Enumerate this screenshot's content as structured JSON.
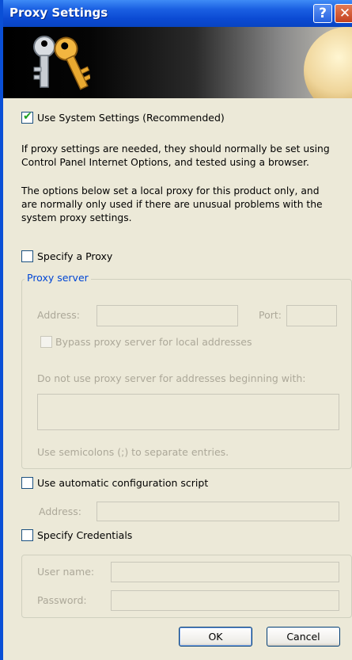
{
  "window": {
    "title": "Proxy Settings",
    "help_glyph": "?",
    "close_glyph": "✕"
  },
  "banner": {
    "icon": "keys-icon"
  },
  "use_system": {
    "label": "Use System Settings (Recommended)",
    "checked": true
  },
  "info": {
    "line1": "If proxy settings are needed, they should normally be set using",
    "line2": "Control Panel Internet Options, and tested using a browser.",
    "line3": "The options below set a local proxy for this product only, and",
    "line4": "are normally only used  if there are unusual problems with the",
    "line5": "system proxy settings."
  },
  "specify_proxy": {
    "label": "Specify a Proxy",
    "checked": false
  },
  "proxy_server": {
    "legend": "Proxy server",
    "address_label": "Address:",
    "address_value": "",
    "port_label": "Port:",
    "port_value": "",
    "bypass_label": "Bypass proxy server for local addresses",
    "exceptions_label": "Do not use proxy server for addresses beginning with:",
    "exceptions_value": "",
    "semicolons_hint": "Use semicolons (;) to separate entries."
  },
  "auto_config": {
    "label": "Use automatic configuration script",
    "checked": false,
    "address_label": "Address:",
    "address_value": ""
  },
  "credentials": {
    "label": "Specify Credentials",
    "checked": false,
    "username_label": "User name:",
    "username_value": "",
    "password_label": "Password:",
    "password_value": ""
  },
  "buttons": {
    "ok": "OK",
    "cancel": "Cancel"
  },
  "colors": {
    "titlebar": "#0b4ad3",
    "dialog_bg": "#ece9d8",
    "legend_text": "#0046d5",
    "disabled_text": "#aca899"
  }
}
